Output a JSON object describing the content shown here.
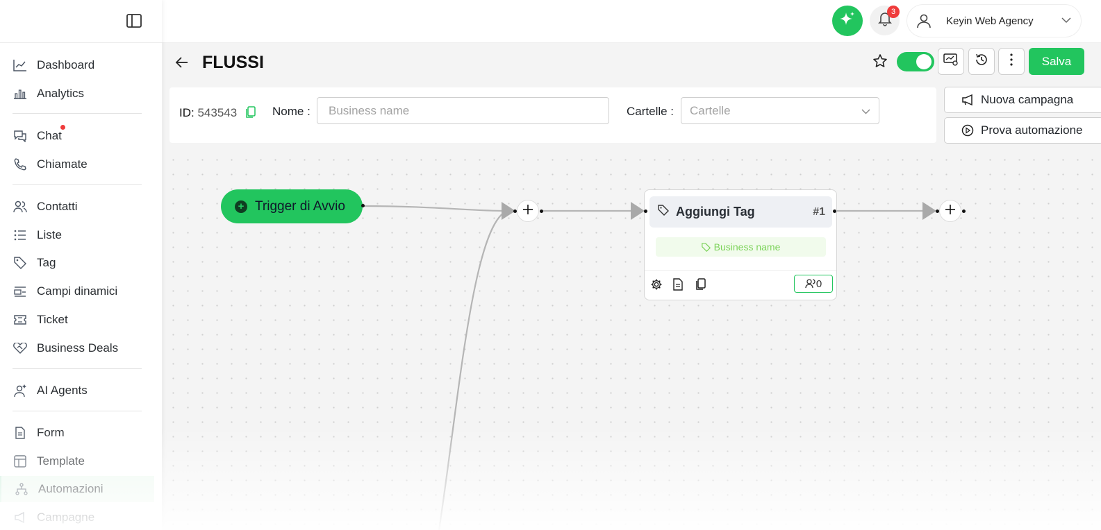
{
  "sidebar": {
    "items": [
      {
        "label": "Dashboard",
        "icon": "line-chart-icon"
      },
      {
        "label": "Analytics",
        "icon": "bar-chart-icon"
      },
      {
        "label": "Chat",
        "icon": "chat-icon"
      },
      {
        "label": "Chiamate",
        "icon": "phone-icon"
      },
      {
        "label": "Contatti",
        "icon": "users-icon"
      },
      {
        "label": "Liste",
        "icon": "list-icon"
      },
      {
        "label": "Tag",
        "icon": "tag-icon"
      },
      {
        "label": "Campi dinamici",
        "icon": "fields-icon"
      },
      {
        "label": "Ticket",
        "icon": "ticket-icon"
      },
      {
        "label": "Business Deals",
        "icon": "handshake-icon"
      },
      {
        "label": "AI Agents",
        "icon": "ai-agent-icon"
      },
      {
        "label": "Form",
        "icon": "document-icon"
      },
      {
        "label": "Template",
        "icon": "template-icon"
      },
      {
        "label": "Automazioni",
        "icon": "flow-icon"
      },
      {
        "label": "Campagne",
        "icon": "megaphone-icon"
      }
    ]
  },
  "topbar": {
    "notifications_count": "3",
    "user_name": "Keyin Web Agency"
  },
  "header": {
    "title": "FLUSSI",
    "save_label": "Salva",
    "active_toggle": true
  },
  "form": {
    "id_label": "ID:",
    "id_value": "543543",
    "name_label": "Nome :",
    "name_placeholder": "Business name",
    "folders_label": "Cartelle :",
    "folders_placeholder": "Cartelle"
  },
  "actions": {
    "new_campaign": "Nuova campagna",
    "test_automation": "Prova automazione"
  },
  "flow": {
    "trigger_label": "Trigger di Avvio",
    "card": {
      "title": "Aggiungi Tag",
      "number": "#1",
      "tag": "Business name",
      "count": "0"
    }
  },
  "colors": {
    "accent": "#22c55e",
    "badge": "#ef3b3b"
  }
}
